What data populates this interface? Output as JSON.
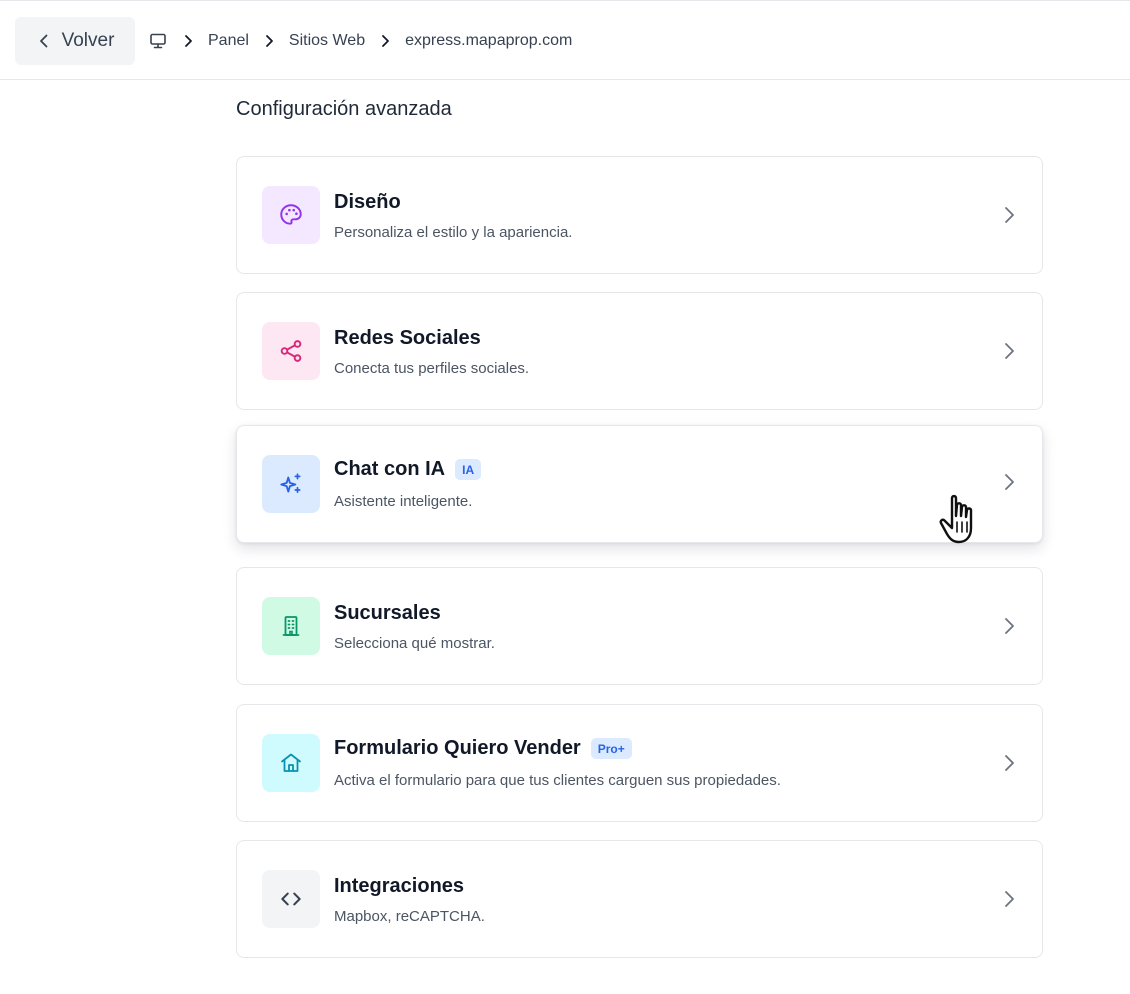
{
  "topbar": {
    "back_label": "Volver",
    "breadcrumbs": [
      "Panel",
      "Sitios Web",
      "express.mapaprop.com"
    ]
  },
  "section_title": "Configuración avanzada",
  "cards": [
    {
      "title": "Diseño",
      "desc": "Personaliza el estilo y la apariencia.",
      "icon": "palette-icon",
      "icon_color": "#9333ea",
      "icon_bg": "#f3e8ff",
      "badge": ""
    },
    {
      "title": "Redes Sociales",
      "desc": "Conecta tus perfiles sociales.",
      "icon": "share-icon",
      "icon_color": "#db2777",
      "icon_bg": "#fce7f3",
      "badge": ""
    },
    {
      "title": "Chat con IA",
      "desc": "Asistente inteligente.",
      "icon": "sparkles-icon",
      "icon_color": "#2563eb",
      "icon_bg": "#dbeafe",
      "badge": "IA"
    },
    {
      "title": "Sucursales",
      "desc": "Selecciona qué mostrar.",
      "icon": "building-icon",
      "icon_color": "#059669",
      "icon_bg": "#d1fae5",
      "badge": ""
    },
    {
      "title": "Formulario Quiero Vender",
      "desc": "Activa el formulario para que tus clientes carguen sus propiedades.",
      "icon": "home-icon",
      "icon_color": "#0891b2",
      "icon_bg": "#cffafe",
      "badge": "Pro+"
    },
    {
      "title": "Integraciones",
      "desc": "Mapbox, reCAPTCHA.",
      "icon": "code-icon",
      "icon_color": "#374151",
      "icon_bg": "#f3f4f6",
      "badge": ""
    }
  ]
}
